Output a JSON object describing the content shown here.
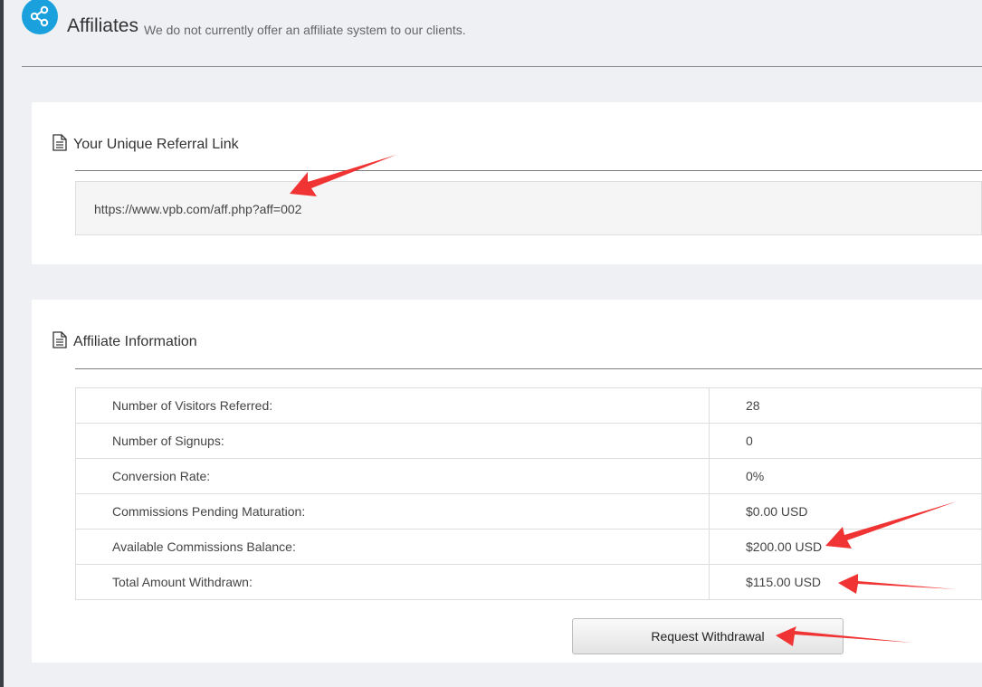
{
  "header": {
    "title": "Affiliates",
    "subtitle": "We do not currently offer an affiliate system to our clients.",
    "icon": "share-icon",
    "accent_color": "#1aa1dd"
  },
  "referral": {
    "heading": "Your Unique Referral Link",
    "heading_icon": "document-icon",
    "link": "https://www.vpb.com/aff.php?aff=002"
  },
  "info": {
    "heading": "Affiliate Information",
    "heading_icon": "document-icon",
    "rows": [
      {
        "label": "Number of Visitors Referred:",
        "value": "28"
      },
      {
        "label": "Number of Signups:",
        "value": "0"
      },
      {
        "label": "Conversion Rate:",
        "value": "0%"
      },
      {
        "label": "Commissions Pending Maturation:",
        "value": "$0.00 USD"
      },
      {
        "label": "Available Commissions Balance:",
        "value": "$200.00 USD"
      },
      {
        "label": "Total Amount Withdrawn:",
        "value": "$115.00 USD"
      }
    ],
    "withdraw_label": "Request Withdrawal"
  },
  "annotation_color": "#f03434"
}
